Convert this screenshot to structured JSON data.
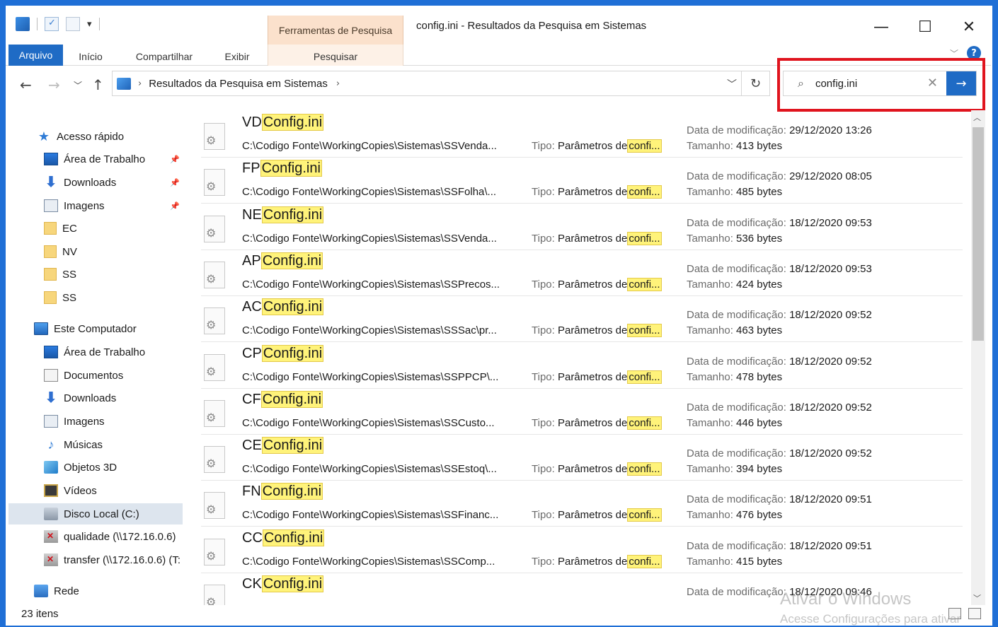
{
  "window": {
    "title": "config.ini - Resultados da Pesquisa em Sistemas",
    "contextual_tab": "Ferramentas de Pesquisa",
    "minimize": "—",
    "maximize": "☐",
    "close": "✕"
  },
  "ribbon": {
    "tabs": [
      "Arquivo",
      "Início",
      "Compartilhar",
      "Exibir",
      "Pesquisar"
    ],
    "help": "?"
  },
  "address": {
    "breadcrumb": "Resultados da Pesquisa em Sistemas"
  },
  "search": {
    "value": "config.ini"
  },
  "sidebar": {
    "items": [
      {
        "label": "Acesso rápido",
        "icon": "star-icon"
      },
      {
        "label": "Área de Trabalho",
        "icon": "desktop-icon",
        "pinned": true
      },
      {
        "label": "Downloads",
        "icon": "download-icon",
        "pinned": true
      },
      {
        "label": "Imagens",
        "icon": "pictures-icon",
        "pinned": true
      },
      {
        "label": "EC",
        "icon": "folder-icon"
      },
      {
        "label": "NV",
        "icon": "folder-icon"
      },
      {
        "label": "SS",
        "icon": "folder-icon"
      },
      {
        "label": "SS",
        "icon": "folder-icon"
      },
      {
        "label": "Este Computador",
        "icon": "computer-icon"
      },
      {
        "label": "Área de Trabalho",
        "icon": "desktop-icon"
      },
      {
        "label": "Documentos",
        "icon": "documents-icon"
      },
      {
        "label": "Downloads",
        "icon": "download-icon"
      },
      {
        "label": "Imagens",
        "icon": "pictures-icon"
      },
      {
        "label": "Músicas",
        "icon": "music-icon"
      },
      {
        "label": "Objetos 3D",
        "icon": "objects-3d-icon"
      },
      {
        "label": "Vídeos",
        "icon": "videos-icon"
      },
      {
        "label": "Disco Local (C:)",
        "icon": "local-disk-icon",
        "selected": true
      },
      {
        "label": "qualidade (\\\\172.16.0.6)",
        "icon": "network-drive-icon"
      },
      {
        "label": "transfer (\\\\172.16.0.6) (T:",
        "icon": "network-drive-icon"
      },
      {
        "label": "Rede",
        "icon": "network-icon"
      }
    ]
  },
  "results": {
    "type_label": "Tipo:",
    "type_value": "Parâmetros de",
    "type_highlight": "confi...",
    "mod_label": "Data de modificação:",
    "size_label": "Tamanho:",
    "items": [
      {
        "prefix": "VD",
        "match": "Config.ini",
        "path": "C:\\Codigo Fonte\\WorkingCopies\\Sistemas\\SSVenda...",
        "modified": "29/12/2020 13:26",
        "size": "413 bytes"
      },
      {
        "prefix": "FP",
        "match": "Config.ini",
        "path": "C:\\Codigo Fonte\\WorkingCopies\\Sistemas\\SSFolha\\...",
        "modified": "29/12/2020 08:05",
        "size": "485 bytes"
      },
      {
        "prefix": "NE",
        "match": "Config.ini",
        "path": "C:\\Codigo Fonte\\WorkingCopies\\Sistemas\\SSVenda...",
        "modified": "18/12/2020 09:53",
        "size": "536 bytes"
      },
      {
        "prefix": "AP",
        "match": "Config.ini",
        "path": "C:\\Codigo Fonte\\WorkingCopies\\Sistemas\\SSPrecos...",
        "modified": "18/12/2020 09:53",
        "size": "424 bytes"
      },
      {
        "prefix": "AC",
        "match": "Config.ini",
        "path": "C:\\Codigo Fonte\\WorkingCopies\\Sistemas\\SSSac\\pr...",
        "modified": "18/12/2020 09:52",
        "size": "463 bytes"
      },
      {
        "prefix": "CP",
        "match": "Config.ini",
        "path": "C:\\Codigo Fonte\\WorkingCopies\\Sistemas\\SSPPCP\\...",
        "modified": "18/12/2020 09:52",
        "size": "478 bytes"
      },
      {
        "prefix": "CF",
        "match": "Config.ini",
        "path": "C:\\Codigo Fonte\\WorkingCopies\\Sistemas\\SSCusto...",
        "modified": "18/12/2020 09:52",
        "size": "446 bytes"
      },
      {
        "prefix": "CE",
        "match": "Config.ini",
        "path": "C:\\Codigo Fonte\\WorkingCopies\\Sistemas\\SSEstoq\\...",
        "modified": "18/12/2020 09:52",
        "size": "394 bytes"
      },
      {
        "prefix": "FN",
        "match": "Config.ini",
        "path": "C:\\Codigo Fonte\\WorkingCopies\\Sistemas\\SSFinanc...",
        "modified": "18/12/2020 09:51",
        "size": "476 bytes"
      },
      {
        "prefix": "CC",
        "match": "Config.ini",
        "path": "C:\\Codigo Fonte\\WorkingCopies\\Sistemas\\SSComp...",
        "modified": "18/12/2020 09:51",
        "size": "415 bytes"
      },
      {
        "prefix": "CK",
        "match": "Config.ini",
        "path": "",
        "modified": "18/12/2020 09:46",
        "size": ""
      }
    ]
  },
  "status": {
    "count": "23 itens"
  },
  "watermark": {
    "line1": "Ativar o Windows",
    "line2": "Acesse Configurações para ativar"
  }
}
